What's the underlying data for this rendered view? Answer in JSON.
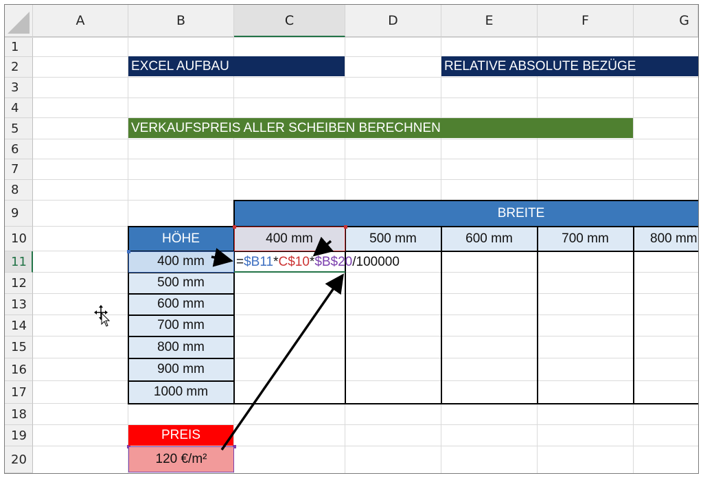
{
  "columns": [
    "A",
    "B",
    "C",
    "D",
    "E",
    "F",
    "G"
  ],
  "rows": [
    "1",
    "2",
    "3",
    "4",
    "5",
    "6",
    "7",
    "8",
    "9",
    "10",
    "11",
    "12",
    "13",
    "14",
    "15",
    "16",
    "17",
    "18",
    "19",
    "20"
  ],
  "selected_column": "C",
  "selected_row": "11",
  "banners": {
    "excel_aufbau": "EXCEL AUFBAU",
    "relative_absolute": "RELATIVE ABSOLUTE BEZÜGE",
    "verkaufspreis": "VERKAUFSPREIS ALLER SCHEIBEN BERECHNEN"
  },
  "table": {
    "width_header": "BREITE",
    "height_header": "HÖHE",
    "widths": [
      "400 mm",
      "500 mm",
      "600 mm",
      "700 mm",
      "800 mm"
    ],
    "heights": [
      "400 mm",
      "500 mm",
      "600 mm",
      "700 mm",
      "800 mm",
      "900 mm",
      "1000 mm"
    ]
  },
  "formula": {
    "eq": "=",
    "ref1": "$B11",
    "op1": "*",
    "ref2": "C$10",
    "op2": "*",
    "ref3": "$B$20",
    "tail": "/100000"
  },
  "price": {
    "label": "PREIS",
    "value": "120 €/m²"
  },
  "colors": {
    "navy": "#0f2a5e",
    "green": "#4f8030",
    "table_header_blue": "#3a78bb",
    "light_blue": "#dde9f5",
    "red": "#ff0000",
    "pink": "#f29a9a",
    "ref1": "#3d6fc1",
    "ref2": "#cc3333",
    "ref3": "#7b3fae",
    "selection_green": "#217346"
  },
  "icons": {
    "pointer": "move-cursor-icon",
    "arrows": "annotation-arrow-icon"
  }
}
